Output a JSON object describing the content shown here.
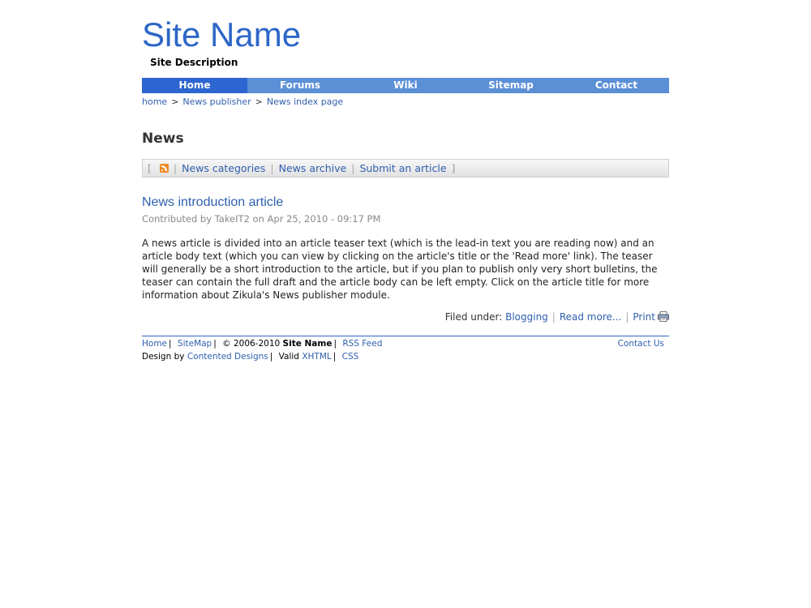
{
  "header": {
    "site_name": "Site Name",
    "site_description": "Site Description"
  },
  "nav": {
    "items": [
      {
        "label": "Home",
        "active": true
      },
      {
        "label": "Forums"
      },
      {
        "label": "Wiki"
      },
      {
        "label": "Sitemap"
      },
      {
        "label": "Contact"
      }
    ]
  },
  "breadcrumb": {
    "items": [
      "home",
      "News publisher",
      "News index page"
    ],
    "separator": ">"
  },
  "page": {
    "title": "News"
  },
  "toolbar": {
    "open_bracket": "[",
    "close_bracket": "]",
    "pipe": "|",
    "rss_icon": "rss-feed-icon",
    "links": [
      "News categories",
      "News archive",
      "Submit an article"
    ]
  },
  "article": {
    "title": "News introduction article",
    "meta": "Contributed by TakeIT2 on Apr 25, 2010 - 09:17 PM",
    "body": "A news article is divided into an article teaser text (which is the lead-in text you are reading now) and an article body text (which you can view by clicking on the article's title or the 'Read more' link). The teaser will generally be a short introduction to the article, but if you plan to publish only very short bulletins, the teaser can contain the full draft and the article body can be left empty. Click on the article title for more information about Zikula's News publisher module.",
    "filed_under_label": "Filed under:",
    "category": "Blogging",
    "read_more": "Read more...",
    "print": "Print",
    "print_icon": "printer-icon"
  },
  "footer": {
    "home": "Home",
    "sitemap": "SiteMap",
    "copyright": "© 2006-2010",
    "site_name": "Site Name",
    "rss_feed": "RSS Feed",
    "contact_us": "Contact Us",
    "design_by_label": "Design by",
    "designer": "Contented Designs",
    "valid_label": "Valid",
    "xhtml": "XHTML",
    "css": "CSS",
    "pipe": "|"
  },
  "colors": {
    "brand_blue": "#2d66c6",
    "nav_bg": "#5b8fd6",
    "nav_active": "#2d66d0",
    "link": "#2f5fae"
  }
}
